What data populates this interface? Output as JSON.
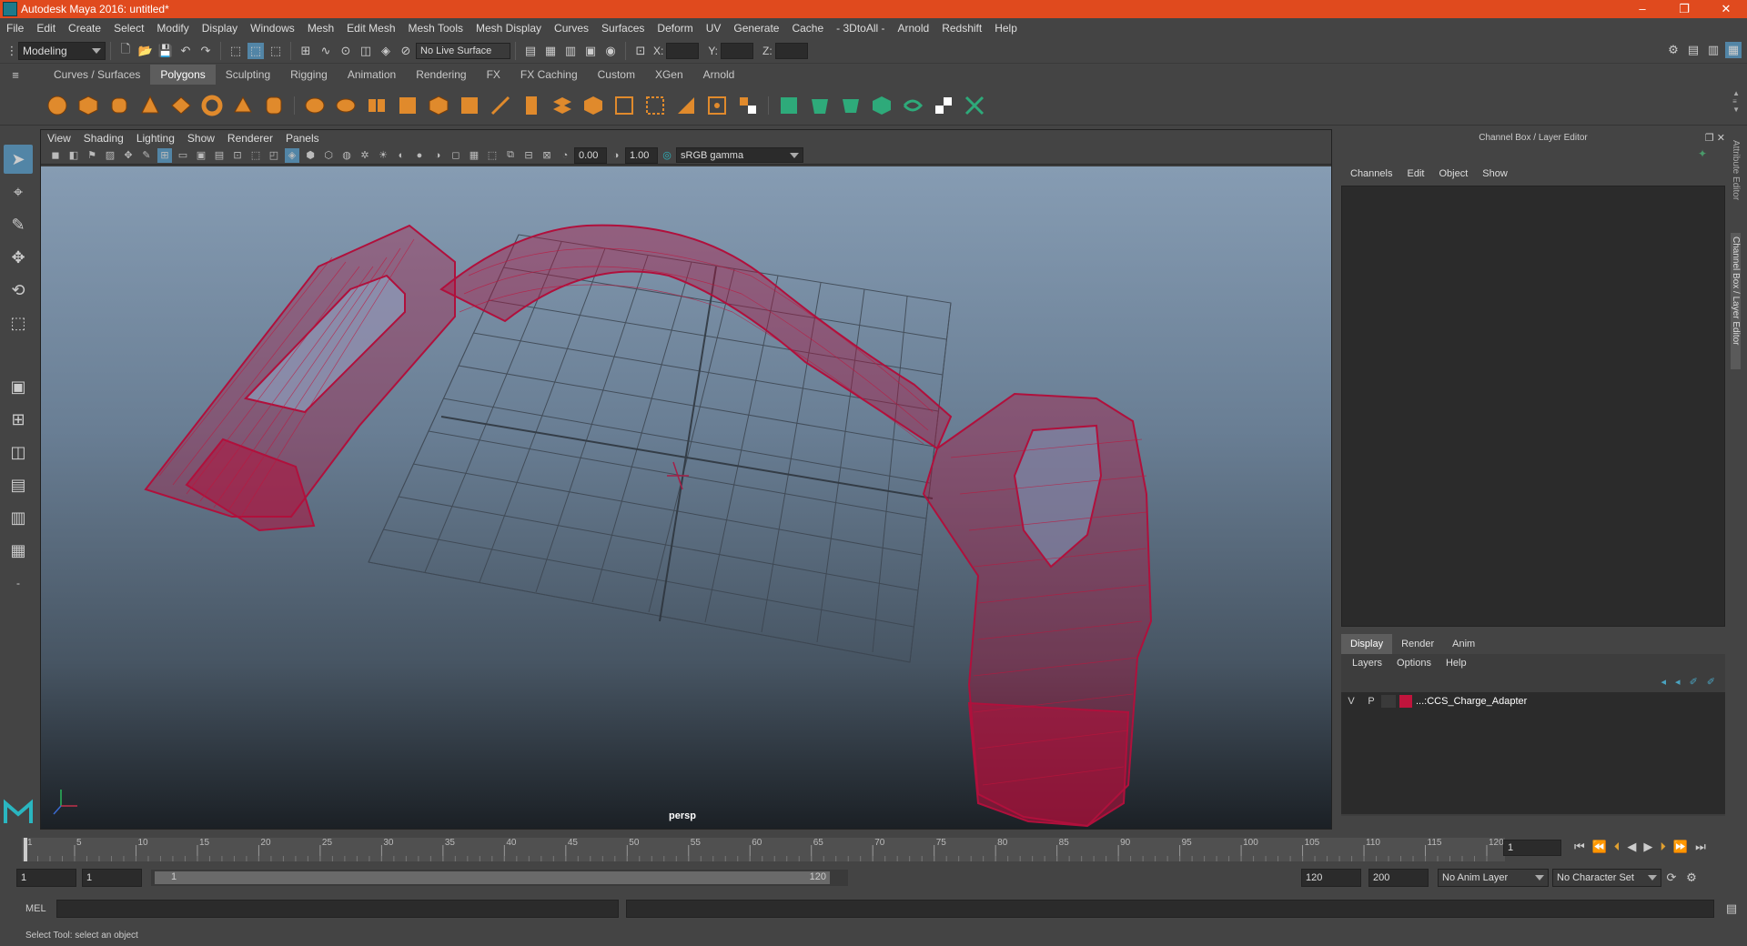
{
  "window": {
    "title": "Autodesk Maya 2016: untitled*",
    "minimize": "–",
    "restore": "❐",
    "close": "✕"
  },
  "menubar": [
    "File",
    "Edit",
    "Create",
    "Select",
    "Modify",
    "Display",
    "Windows",
    "Mesh",
    "Edit Mesh",
    "Mesh Tools",
    "Mesh Display",
    "Curves",
    "Surfaces",
    "Deform",
    "UV",
    "Generate",
    "Cache",
    "- 3DtoAll -",
    "Arnold",
    "Redshift",
    "Help"
  ],
  "statusline": {
    "mode": "Modeling",
    "live_surface": "No Live Surface",
    "x_label": "X:",
    "y_label": "Y:",
    "z_label": "Z:"
  },
  "shelf_tabs": [
    "Curves / Surfaces",
    "Polygons",
    "Sculpting",
    "Rigging",
    "Animation",
    "Rendering",
    "FX",
    "FX Caching",
    "Custom",
    "XGen",
    "Arnold"
  ],
  "shelf_active": "Polygons",
  "viewport": {
    "menus": [
      "View",
      "Shading",
      "Lighting",
      "Show",
      "Renderer",
      "Panels"
    ],
    "exposure": "0.00",
    "gamma": "1.00",
    "color_space": "sRGB gamma",
    "camera_label": "persp"
  },
  "channel_box": {
    "title": "Channel Box / Layer Editor",
    "menus": [
      "Channels",
      "Edit",
      "Object",
      "Show"
    ]
  },
  "layer_editor": {
    "tabs": [
      "Display",
      "Render",
      "Anim"
    ],
    "active_tab": "Display",
    "menus": [
      "Layers",
      "Options",
      "Help"
    ],
    "layers": [
      {
        "visible": "V",
        "playback": "P",
        "name": "...:CCS_Charge_Adapter",
        "color": "#c0143c"
      }
    ]
  },
  "side_tabs": [
    "Attribute Editor",
    "Channel Box / Layer Editor"
  ],
  "timeline": {
    "ticks": [
      "1",
      "5",
      "10",
      "15",
      "20",
      "25",
      "30",
      "35",
      "40",
      "45",
      "50",
      "55",
      "60",
      "65",
      "70",
      "75",
      "80",
      "85",
      "90",
      "95",
      "100",
      "105",
      "110",
      "115",
      "120"
    ],
    "current_frame": "1"
  },
  "range": {
    "start": "1",
    "playback_start": "1",
    "slider_start": "1",
    "slider_end": "120",
    "playback_end": "120",
    "end": "200",
    "anim_layer": "No Anim Layer",
    "character_set": "No Character Set"
  },
  "command": {
    "label": "MEL"
  },
  "help_line": "Select Tool: select an object",
  "colors": {
    "title_bar": "#e04a1e",
    "wireframe": "#b0103c",
    "shelf_icon": "#e08a2c",
    "shelf_icon_green": "#2eaa7a"
  }
}
